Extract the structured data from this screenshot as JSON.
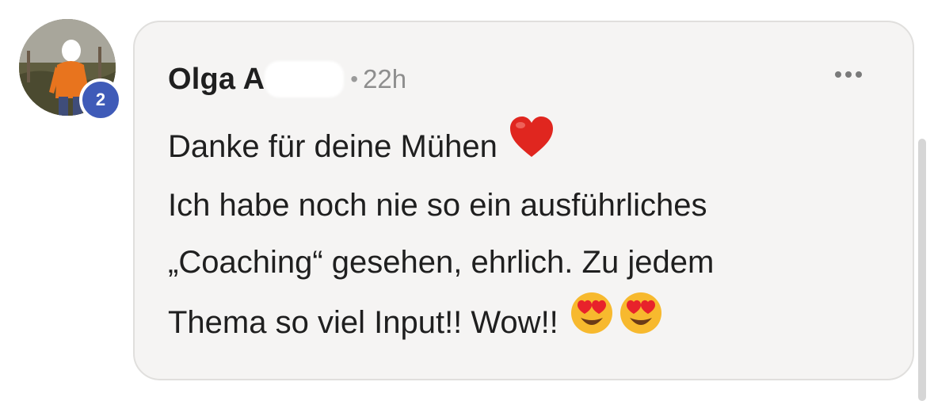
{
  "comment": {
    "author": "Olga A",
    "timestamp": "22h",
    "separator": "•",
    "level_badge": "2",
    "lines": [
      "Danke für deine Mühen",
      "Ich habe noch nie so ein ausführliches",
      "„Coaching“ gesehen, ehrlich. Zu jedem",
      "Thema so viel Input!! Wow!!"
    ],
    "emojis": {
      "line1": "red-heart",
      "line4": [
        "heart-eyes-face",
        "heart-eyes-face"
      ]
    }
  },
  "colors": {
    "badge": "#3f5bb8",
    "bubble_bg": "#f5f4f3",
    "timestamp": "#8e8e8e"
  },
  "icons": {
    "more": "more-horizontal-icon"
  }
}
